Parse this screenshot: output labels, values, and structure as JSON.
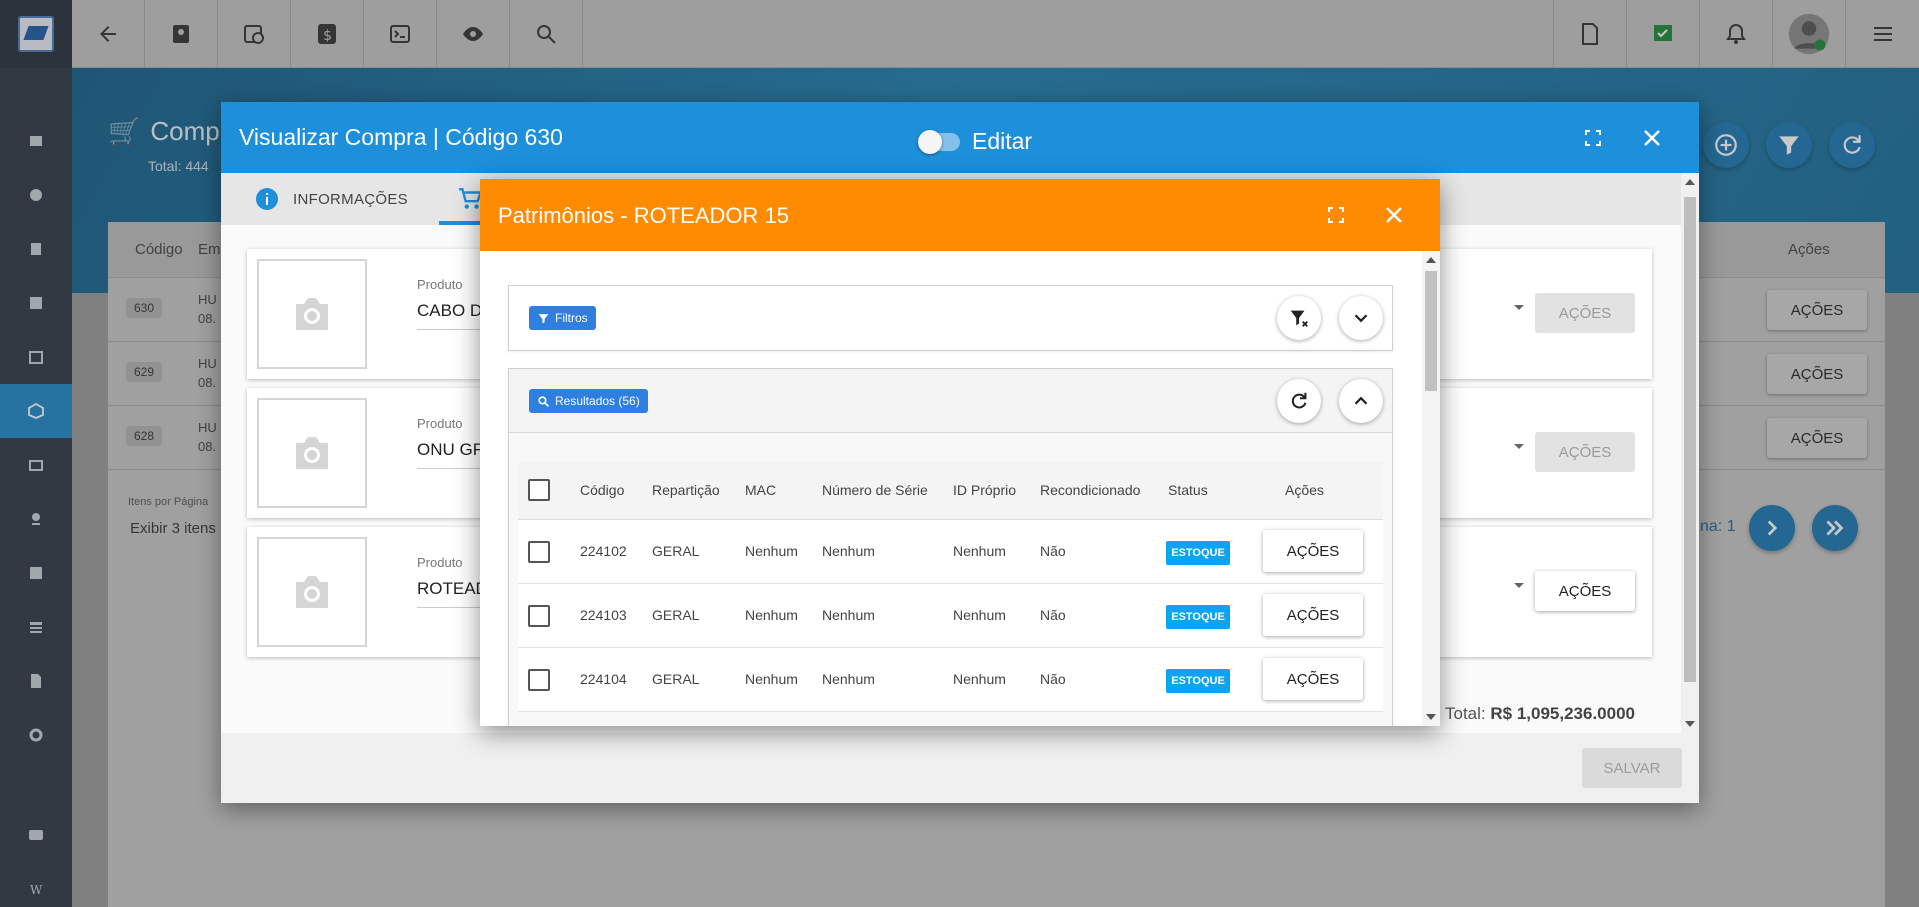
{
  "app": {
    "page_title": "Comp",
    "page_subtitle": "Total: 444",
    "topbar_icons": [
      "back-arrow-icon",
      "contact-card-icon",
      "calendar-clock-icon",
      "dollar-icon",
      "terminal-icon",
      "eye-icon",
      "search-icon",
      "pdf-icon",
      "task-check-icon",
      "bell-icon",
      "avatar",
      "menu-icon"
    ],
    "table_headers": [
      "Código",
      "Em",
      "Ações"
    ],
    "rows": [
      {
        "code": "630",
        "name_a": "HU",
        "name_b": "08."
      },
      {
        "code": "629",
        "name_a": "HU",
        "name_b": "08."
      },
      {
        "code": "628",
        "name_a": "HU",
        "name_b": "08."
      }
    ],
    "row_action_label": "AÇÕES",
    "items_per_page_label": "Itens por Página",
    "items_per_page_value": "Exibir 3 itens p",
    "page_label": "na: 1"
  },
  "modal1": {
    "title": "Visualizar Compra | Código 630",
    "edit_label": "Editar",
    "tabs": [
      {
        "label": "INFORMAÇÕES"
      }
    ],
    "products": [
      {
        "label": "Produto",
        "value": "CABO D",
        "action": "AÇÕES",
        "enabled": false
      },
      {
        "label": "Produto",
        "value": "ONU GF",
        "action": "AÇÕES",
        "enabled": false
      },
      {
        "label": "Produto",
        "value": "ROTEAD",
        "action": "AÇÕES",
        "enabled": true
      }
    ],
    "total_label": "Total:",
    "total_value": "R$ 1,095,236.0000",
    "save_label": "SALVAR"
  },
  "modal2": {
    "title": "Patrimônios - ROTEADOR 15",
    "filters_chip": "Filtros",
    "results_chip": "Resultados (56)",
    "columns": [
      "Código",
      "Repartição",
      "MAC",
      "Número de Série",
      "ID Próprio",
      "Recondicionado",
      "Status",
      "Ações"
    ],
    "rows": [
      {
        "codigo": "224102",
        "reparticao": "GERAL",
        "mac": "Nenhum",
        "serie": "Nenhum",
        "id_proprio": "Nenhum",
        "recondicionado": "Não",
        "status": "ESTOQUE",
        "acoes": "AÇÕES"
      },
      {
        "codigo": "224103",
        "reparticao": "GERAL",
        "mac": "Nenhum",
        "serie": "Nenhum",
        "id_proprio": "Nenhum",
        "recondicionado": "Não",
        "status": "ESTOQUE",
        "acoes": "AÇÕES"
      },
      {
        "codigo": "224104",
        "reparticao": "GERAL",
        "mac": "Nenhum",
        "serie": "Nenhum",
        "id_proprio": "Nenhum",
        "recondicionado": "Não",
        "status": "ESTOQUE",
        "acoes": "AÇÕES"
      }
    ]
  },
  "colors": {
    "primary": "#1e8fdb",
    "accent_orange": "#ff8c00",
    "status_badge": "#0aa5f0",
    "chip_blue": "#2f7fe0",
    "sidebar": "#2d3846"
  }
}
